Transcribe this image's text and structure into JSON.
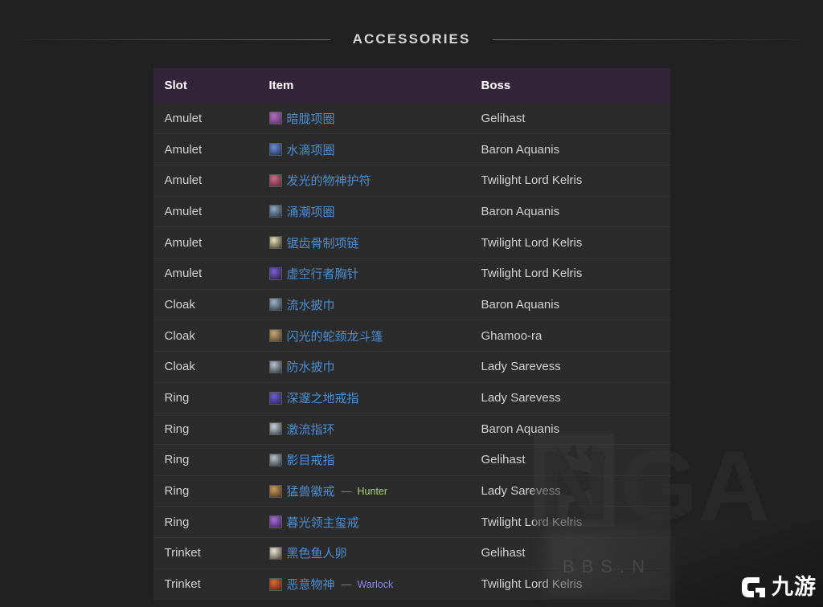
{
  "section": {
    "title": "ACCESSORIES"
  },
  "table": {
    "columns": [
      {
        "key": "slot",
        "label": "Slot"
      },
      {
        "key": "item",
        "label": "Item"
      },
      {
        "key": "boss",
        "label": "Boss"
      }
    ],
    "header_bg": "#33243a",
    "row_bg": "#2b2b2b",
    "link_color": "#4a8fd4",
    "rows": [
      {
        "slot": "Amulet",
        "item": "暗胧项圈",
        "class_tag": "",
        "class_color": "",
        "boss": "Gelihast",
        "icon_colors": [
          "#b06ec0",
          "#5a2f66"
        ]
      },
      {
        "slot": "Amulet",
        "item": "水滴项圈",
        "class_tag": "",
        "class_color": "",
        "boss": "Baron Aquanis",
        "icon_colors": [
          "#6b8fd8",
          "#1f2a4a"
        ]
      },
      {
        "slot": "Amulet",
        "item": "发光的物神护符",
        "class_tag": "",
        "class_color": "",
        "boss": "Twilight Lord Kelris",
        "icon_colors": [
          "#d06a8a",
          "#5c2430"
        ]
      },
      {
        "slot": "Amulet",
        "item": "涌潮项圈",
        "class_tag": "",
        "class_color": "",
        "boss": "Baron Aquanis",
        "icon_colors": [
          "#8fa8c4",
          "#24303f"
        ]
      },
      {
        "slot": "Amulet",
        "item": "锯齿骨制项链",
        "class_tag": "",
        "class_color": "",
        "boss": "Twilight Lord Kelris",
        "icon_colors": [
          "#e8e0b8",
          "#3a3426"
        ]
      },
      {
        "slot": "Amulet",
        "item": "虚空行者胸针",
        "class_tag": "",
        "class_color": "",
        "boss": "Twilight Lord Kelris",
        "icon_colors": [
          "#7f5fd0",
          "#241a44"
        ]
      },
      {
        "slot": "Cloak",
        "item": "流水披巾",
        "class_tag": "",
        "class_color": "",
        "boss": "Baron Aquanis",
        "icon_colors": [
          "#9fb4c8",
          "#2a3642"
        ]
      },
      {
        "slot": "Cloak",
        "item": "闪光的蛇颈龙斗篷",
        "class_tag": "",
        "class_color": "",
        "boss": "Ghamoo-ra",
        "icon_colors": [
          "#c9a878",
          "#4a3a24"
        ]
      },
      {
        "slot": "Cloak",
        "item": "防水披巾",
        "class_tag": "",
        "class_color": "",
        "boss": "Lady Sarevess",
        "icon_colors": [
          "#b9c3cc",
          "#2b3138"
        ]
      },
      {
        "slot": "Ring",
        "item": "深邃之地戒指",
        "class_tag": "",
        "class_color": "",
        "boss": "Lady Sarevess",
        "icon_colors": [
          "#6b5fd6",
          "#2a2256"
        ]
      },
      {
        "slot": "Ring",
        "item": "激流指环",
        "class_tag": "",
        "class_color": "",
        "boss": "Baron Aquanis",
        "icon_colors": [
          "#c8d2dc",
          "#333a42"
        ]
      },
      {
        "slot": "Ring",
        "item": "影目戒指",
        "class_tag": "",
        "class_color": "",
        "boss": "Gelihast",
        "icon_colors": [
          "#b6c2cc",
          "#2e343a"
        ]
      },
      {
        "slot": "Ring",
        "item": "猛兽徽戒",
        "class_tag": "Hunter",
        "class_color": "#abd473",
        "boss": "Lady Sarevess",
        "icon_colors": [
          "#c79a62",
          "#4a3318"
        ]
      },
      {
        "slot": "Ring",
        "item": "暮光领主玺戒",
        "class_tag": "",
        "class_color": "",
        "boss": "Twilight Lord Kelris",
        "icon_colors": [
          "#a96fd8",
          "#3a1e55"
        ]
      },
      {
        "slot": "Trinket",
        "item": "黑色鱼人卵",
        "class_tag": "",
        "class_color": "",
        "boss": "Gelihast",
        "icon_colors": [
          "#e8e4da",
          "#4a4436"
        ]
      },
      {
        "slot": "Trinket",
        "item": "恶意物神",
        "class_tag": "Warlock",
        "class_color": "#8787ed",
        "boss": "Twilight Lord Kelris",
        "icon_colors": [
          "#e06838",
          "#5c1e10"
        ]
      }
    ],
    "class_separator": "—"
  },
  "watermarks": {
    "nga_label": "NGA",
    "bbs_label": "BBS.N",
    "corner_label": "九游"
  }
}
